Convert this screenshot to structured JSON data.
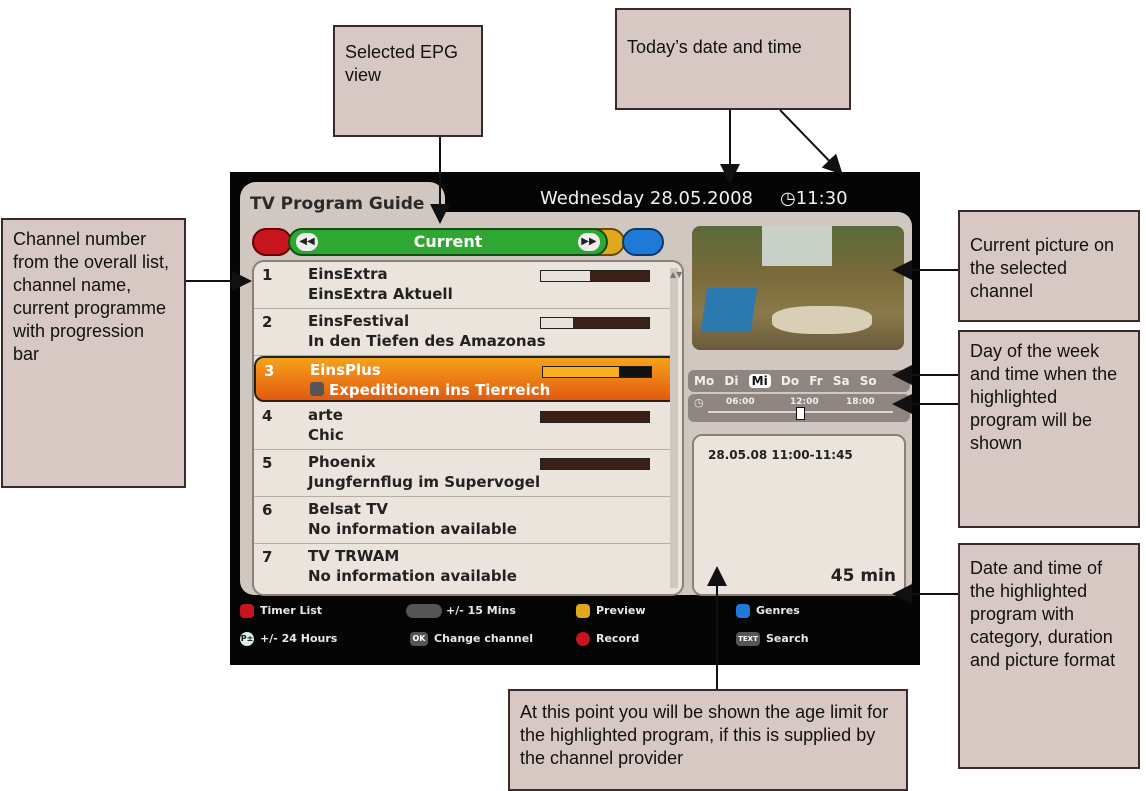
{
  "callouts": {
    "epg_view": "Selected EPG view",
    "date_time": "Today’s date and time",
    "channel_info": "Channel number from the overall list, channel name, current programme with progression bar",
    "current_picture": "Current picture on the selected channel",
    "day_of_week": "Day of the week and time when the highlighted program will be shown",
    "date_time_program": "Date and time of the highlighted program with category, duration and picture format",
    "age_limit": "At this point you will be shown the age limit for the highlighted program, if this is supplied by the channel provider"
  },
  "tv": {
    "title": "TV Program Guide",
    "date": "Wednesday 28.05.2008",
    "time": "11:30",
    "view_label": "Current",
    "channels": [
      {
        "num": "1",
        "name": "EinsExtra",
        "program": "EinsExtra Aktuell",
        "progress": 0.45
      },
      {
        "num": "2",
        "name": "EinsFestival",
        "program": "In den Tiefen des Amazonas",
        "progress": 0.3
      },
      {
        "num": "3",
        "name": "EinsPlus",
        "program": "Expeditionen ins Tierreich",
        "progress": 0.7
      },
      {
        "num": "4",
        "name": "arte",
        "program": "Chic",
        "progress": 0.0
      },
      {
        "num": "5",
        "name": "Phoenix",
        "program": "Jungfernflug im Supervogel",
        "progress": 0.0
      },
      {
        "num": "6",
        "name": "Belsat TV",
        "program": "No information available",
        "progress": null
      },
      {
        "num": "7",
        "name": "TV TRWAM",
        "program": "No information available",
        "progress": null
      }
    ],
    "days": [
      "Mo",
      "Di",
      "Mi",
      "Do",
      "Fr",
      "Sa",
      "So"
    ],
    "current_day": "Mi",
    "times": [
      "06:00",
      "12:00",
      "18:00"
    ],
    "info_date": "28.05.08  11:00-11:45",
    "info_duration": "45 min",
    "legend": {
      "timer_list": "Timer List",
      "plus_minus_15": "+/- 15 Mins",
      "preview": "Preview",
      "genres": "Genres",
      "plus_minus_24": "+/- 24 Hours",
      "change_channel": "Change channel",
      "record": "Record",
      "search": "Search",
      "ok_icon": "OK",
      "text_icon": "TEXT",
      "p_icon": "P±"
    }
  }
}
